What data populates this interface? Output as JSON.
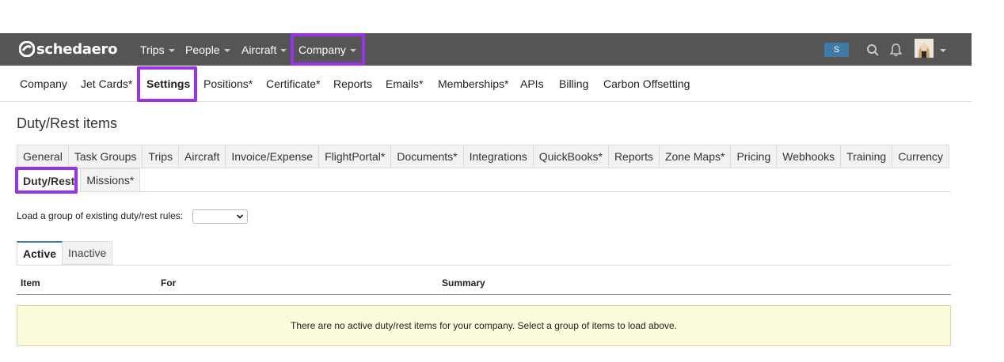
{
  "app": {
    "brand": "schedaero"
  },
  "topnav": {
    "menus": [
      {
        "label": "Trips"
      },
      {
        "label": "People"
      },
      {
        "label": "Aircraft"
      },
      {
        "label": "Company"
      }
    ],
    "user_badge": "S",
    "icons": [
      "search-icon",
      "bell-icon",
      "chevron-down-icon"
    ]
  },
  "subnav": {
    "items": [
      {
        "label": "Company"
      },
      {
        "label": "Jet Cards*"
      },
      {
        "label": "Settings"
      },
      {
        "label": "Positions*"
      },
      {
        "label": "Certificate*"
      },
      {
        "label": "Reports"
      },
      {
        "label": "Emails*"
      },
      {
        "label": "Memberships*"
      },
      {
        "label": "APIs"
      },
      {
        "label": "Billing"
      },
      {
        "label": "Carbon Offsetting"
      }
    ],
    "active": "Settings"
  },
  "page": {
    "title": "Duty/Rest items"
  },
  "settings_tabs": {
    "row1": [
      {
        "label": "General"
      },
      {
        "label": "Task Groups"
      },
      {
        "label": "Trips"
      },
      {
        "label": "Aircraft"
      },
      {
        "label": "Invoice/Expense"
      },
      {
        "label": "FlightPortal*"
      },
      {
        "label": "Documents*"
      },
      {
        "label": "Integrations"
      },
      {
        "label": "QuickBooks*"
      },
      {
        "label": "Reports"
      },
      {
        "label": "Zone Maps*"
      },
      {
        "label": "Pricing"
      },
      {
        "label": "Webhooks"
      },
      {
        "label": "Training"
      },
      {
        "label": "Currency"
      }
    ],
    "row2": [
      {
        "label": "Duty/Rest"
      },
      {
        "label": "Missions*"
      }
    ],
    "active": "Duty/Rest"
  },
  "load_group": {
    "label": "Load a group of existing duty/rest rules:",
    "selected": ""
  },
  "status_tabs": {
    "active_label": "Active",
    "inactive_label": "Inactive"
  },
  "table": {
    "columns": [
      "Item",
      "For",
      "Summary"
    ],
    "empty_message": "There are no active duty/rest items for your company. Select a group of items to load above."
  },
  "colors": {
    "highlight": "#9933e6",
    "topbar": "#555555",
    "accent": "#3e7aa6",
    "empty_bg": "#fbfbdc"
  }
}
